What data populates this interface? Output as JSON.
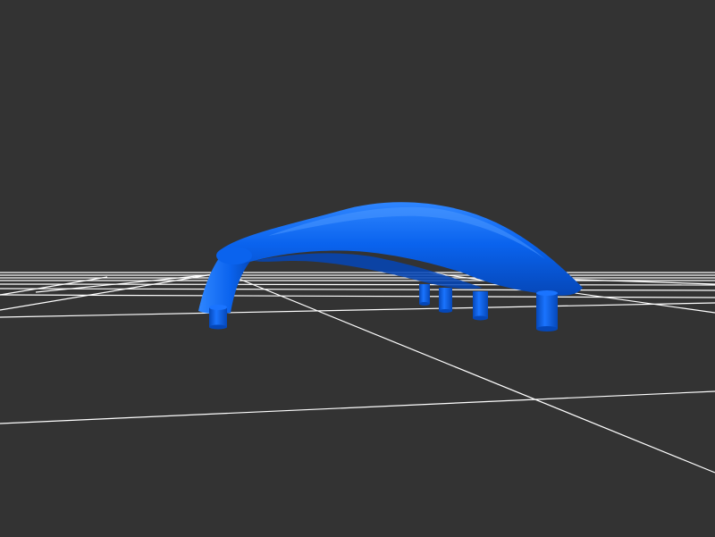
{
  "viewer": {
    "background_color": "#333333",
    "grid_color": "#ffffff",
    "model_color": "#0a63ee",
    "model_highlight_color": "#2f86ff",
    "model_shadow_color": "#0547b8",
    "model": "arched-bridge-with-support-posts",
    "grid": true
  }
}
